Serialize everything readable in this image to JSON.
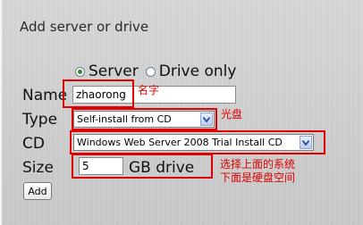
{
  "title": "Add server or drive",
  "radio": {
    "server_label": "Server",
    "drive_only_label": "Drive only",
    "selected": "Server"
  },
  "name": {
    "label": "Name",
    "value": "zhaorong",
    "note": "名字"
  },
  "type": {
    "label": "Type",
    "selected": "Self-install from CD",
    "note": "光盘"
  },
  "cd": {
    "label": "CD",
    "selected": "Windows Web Server 2008 Trial Install CD"
  },
  "size": {
    "label": "Size",
    "value": "5",
    "unit": "GB drive",
    "note_line1": "选择上面的系统",
    "note_line2": "下面是硬盘空间"
  },
  "add_button": "Add",
  "colors": {
    "annotation": "#e00000",
    "radio_selected": "#2a8a2a",
    "dropdown_arrow": "#2a4d9c"
  }
}
